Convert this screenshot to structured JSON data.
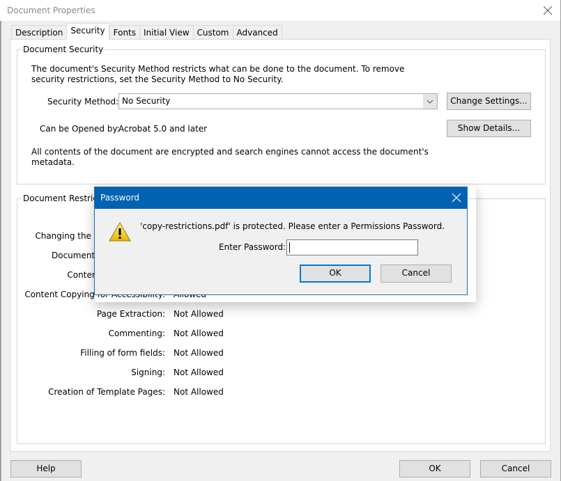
{
  "window": {
    "title": "Document Properties",
    "close_icon": "close-icon"
  },
  "tabs": [
    {
      "label": "Description",
      "active": false
    },
    {
      "label": "Security",
      "active": true
    },
    {
      "label": "Fonts",
      "active": false
    },
    {
      "label": "Initial View",
      "active": false
    },
    {
      "label": "Custom",
      "active": false
    },
    {
      "label": "Advanced",
      "active": false
    }
  ],
  "document_security": {
    "title": "Document Security",
    "description_line1": "The document's Security Method restricts what can be done to the document. To remove",
    "description_line2": "security restrictions, set the Security Method to No Security.",
    "security_method_label": "Security Method:",
    "security_method_value": "No Security",
    "change_settings_label": "Change Settings...",
    "opened_by_label": "Can be Opened by:",
    "opened_by_value": "Acrobat 5.0 and later",
    "show_details_label": "Show Details...",
    "encryption_note_line1": "All contents of the document are encrypted and search engines cannot access the document's",
    "encryption_note_line2": "metadata."
  },
  "document_restrictions": {
    "title": "Document Restrictions Summary",
    "rows": [
      {
        "label": "Changing the Document:",
        "value": ""
      },
      {
        "label": "Document Assembly:",
        "value": ""
      },
      {
        "label": "Content Copying:",
        "value": ""
      },
      {
        "label": "Content Copying for Accessibility:",
        "value": "Allowed"
      },
      {
        "label": "Page Extraction:",
        "value": "Not Allowed"
      },
      {
        "label": "Commenting:",
        "value": "Not Allowed"
      },
      {
        "label": "Filling of form fields:",
        "value": "Not Allowed"
      },
      {
        "label": "Signing:",
        "value": "Not Allowed"
      },
      {
        "label": "Creation of Template Pages:",
        "value": "Not Allowed"
      }
    ],
    "visible_partial": {
      "row0": "Chang",
      "row1": "Do"
    }
  },
  "footer": {
    "help_label": "Help",
    "ok_label": "OK",
    "cancel_label": "Cancel"
  },
  "password_dialog": {
    "title": "Password",
    "message": "'copy-restrictions.pdf' is protected. Please enter a Permissions Password.",
    "password_label": "Enter Password:",
    "password_value": "",
    "ok_label": "OK",
    "cancel_label": "Cancel",
    "icon": "warning-icon",
    "title_bar_color": "#0063b1"
  }
}
